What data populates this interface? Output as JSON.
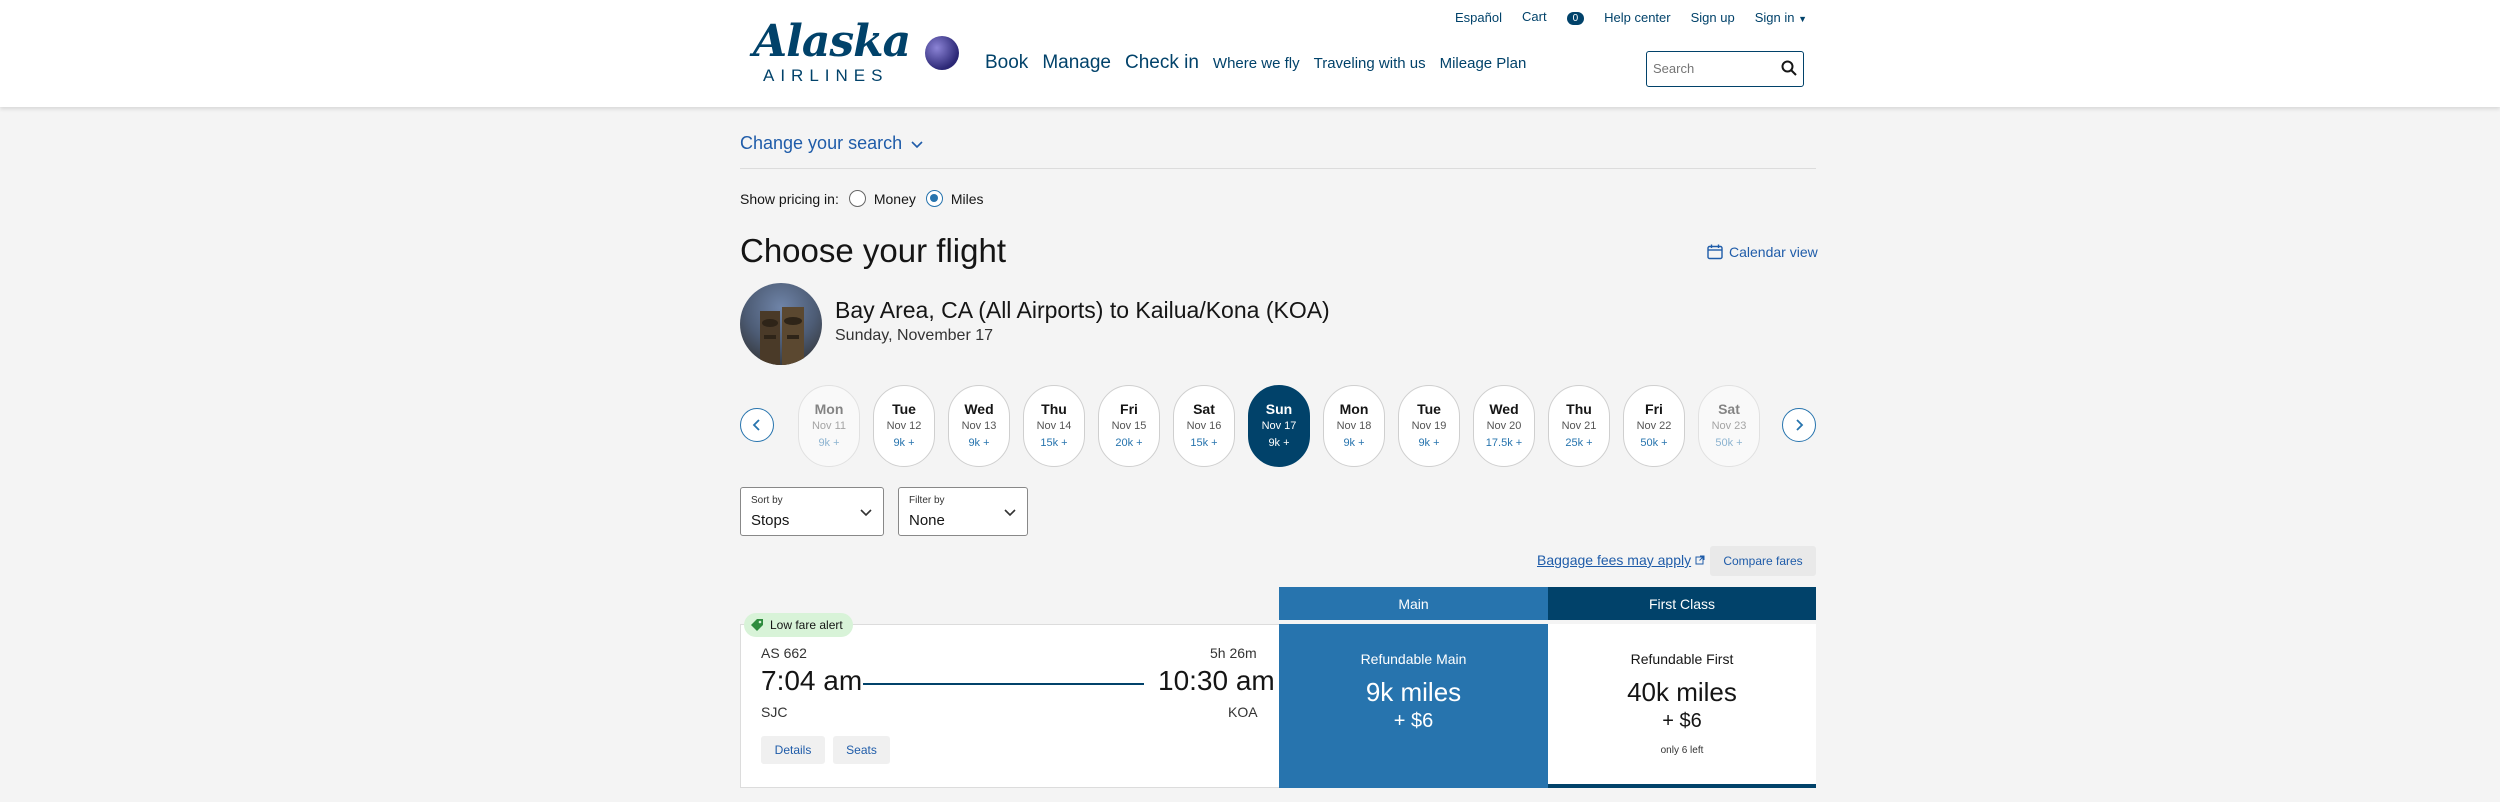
{
  "header": {
    "logo_script": "Alaska",
    "logo_sub": "AIRLINES",
    "top_links": {
      "espanol": "Español",
      "cart": "Cart",
      "cart_count": "0",
      "help": "Help center",
      "signup": "Sign up",
      "signin": "Sign in"
    },
    "nav": {
      "book": "Book",
      "manage": "Manage",
      "checkin": "Check in",
      "where": "Where we fly",
      "traveling": "Traveling with us",
      "mileage": "Mileage Plan"
    },
    "search_placeholder": "Search"
  },
  "search_change": "Change your search",
  "pricing": {
    "label": "Show pricing in:",
    "money": "Money",
    "miles": "Miles",
    "selected": "Miles"
  },
  "page_title": "Choose your flight",
  "calendar_view": "Calendar view",
  "route": {
    "title": "Bay Area, CA (All Airports) to Kailua/Kona (KOA)",
    "date": "Sunday, November 17"
  },
  "dates": [
    {
      "dow": "Mon",
      "date": "Nov 11",
      "price": "9k +",
      "state": "fade"
    },
    {
      "dow": "Tue",
      "date": "Nov 12",
      "price": "9k +",
      "state": ""
    },
    {
      "dow": "Wed",
      "date": "Nov 13",
      "price": "9k +",
      "state": ""
    },
    {
      "dow": "Thu",
      "date": "Nov 14",
      "price": "15k +",
      "state": ""
    },
    {
      "dow": "Fri",
      "date": "Nov 15",
      "price": "20k +",
      "state": ""
    },
    {
      "dow": "Sat",
      "date": "Nov 16",
      "price": "15k +",
      "state": ""
    },
    {
      "dow": "Sun",
      "date": "Nov 17",
      "price": "9k +",
      "state": "sel"
    },
    {
      "dow": "Mon",
      "date": "Nov 18",
      "price": "9k +",
      "state": ""
    },
    {
      "dow": "Tue",
      "date": "Nov 19",
      "price": "9k +",
      "state": ""
    },
    {
      "dow": "Wed",
      "date": "Nov 20",
      "price": "17.5k +",
      "state": ""
    },
    {
      "dow": "Thu",
      "date": "Nov 21",
      "price": "25k +",
      "state": ""
    },
    {
      "dow": "Fri",
      "date": "Nov 22",
      "price": "50k +",
      "state": ""
    },
    {
      "dow": "Sat",
      "date": "Nov 23",
      "price": "50k +",
      "state": "fade"
    }
  ],
  "sort": {
    "label": "Sort by",
    "value": "Stops"
  },
  "filter": {
    "label": "Filter by",
    "value": "None"
  },
  "baggage": "Baggage fees may apply",
  "compare": "Compare fares",
  "tabs": {
    "main": "Main",
    "first": "First Class"
  },
  "flight": {
    "alert": "Low fare alert",
    "number": "AS 662",
    "duration": "5h 26m",
    "depart": "7:04 am",
    "arrive": "10:30 am",
    "origin": "SJC",
    "destination": "KOA",
    "details": "Details",
    "seats": "Seats"
  },
  "fares": {
    "main": {
      "name": "Refundable Main",
      "miles": "9k miles",
      "fee": "+ $6"
    },
    "first": {
      "name": "Refundable First",
      "miles": "40k miles",
      "fee": "+ $6",
      "left": "only 6 left"
    }
  },
  "colors": {
    "brand_navy": "#01426a",
    "main_blue": "#2774ae",
    "link_blue": "#1f5ca9",
    "low_fare_green": "#d8f3d8"
  }
}
